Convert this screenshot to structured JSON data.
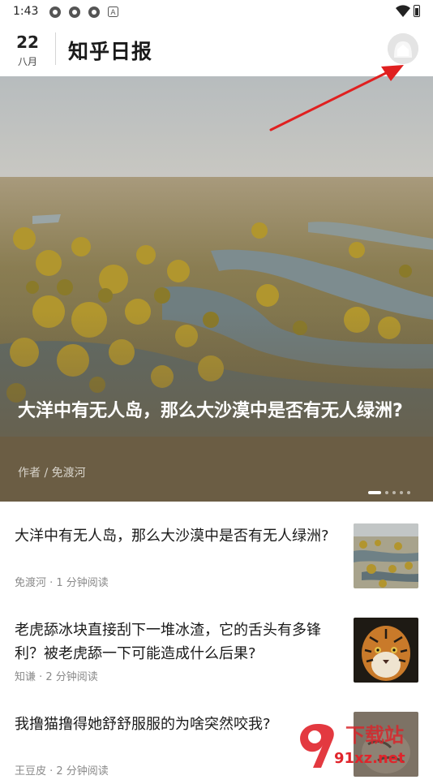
{
  "status_bar": {
    "time": "1:43",
    "icons": [
      "app-icon",
      "app-icon",
      "app-icon",
      "a-badge-icon"
    ],
    "right_icons": [
      "wifi-icon",
      "battery-icon"
    ]
  },
  "header": {
    "day": "22",
    "month": "八月",
    "title": "知乎日报",
    "avatar_icon": "avatar-icon"
  },
  "hero": {
    "title": "大洋中有无人岛，那么大沙漠中是否有无人绿洲?",
    "author": "作者 / 免渡河",
    "page_count": 5,
    "active_page": 1
  },
  "articles": [
    {
      "title": "大洋中有无人岛，那么大沙漠中是否有无人绿洲?",
      "meta": "免渡河 · 1 分钟阅读",
      "thumb": "desert-oasis-thumbnail"
    },
    {
      "title": "老虎舔冰块直接刮下一堆冰渣，它的舌头有多锋利？被老虎舔一下可能造成什么后果?",
      "meta": "知谦 · 2 分钟阅读",
      "thumb": "tiger-thumbnail"
    },
    {
      "title": "我撸猫撸得她舒舒服服的为啥突然咬我?",
      "meta": "王豆皮 · 2 分钟阅读",
      "thumb": "cat-thumbnail"
    }
  ],
  "watermark": {
    "site_text": "下载站",
    "url_text": "91xz.net"
  },
  "colors": {
    "hero_overlay": "#6b5d44",
    "annotation_arrow": "#e02020",
    "watermark": "#e0242b"
  }
}
